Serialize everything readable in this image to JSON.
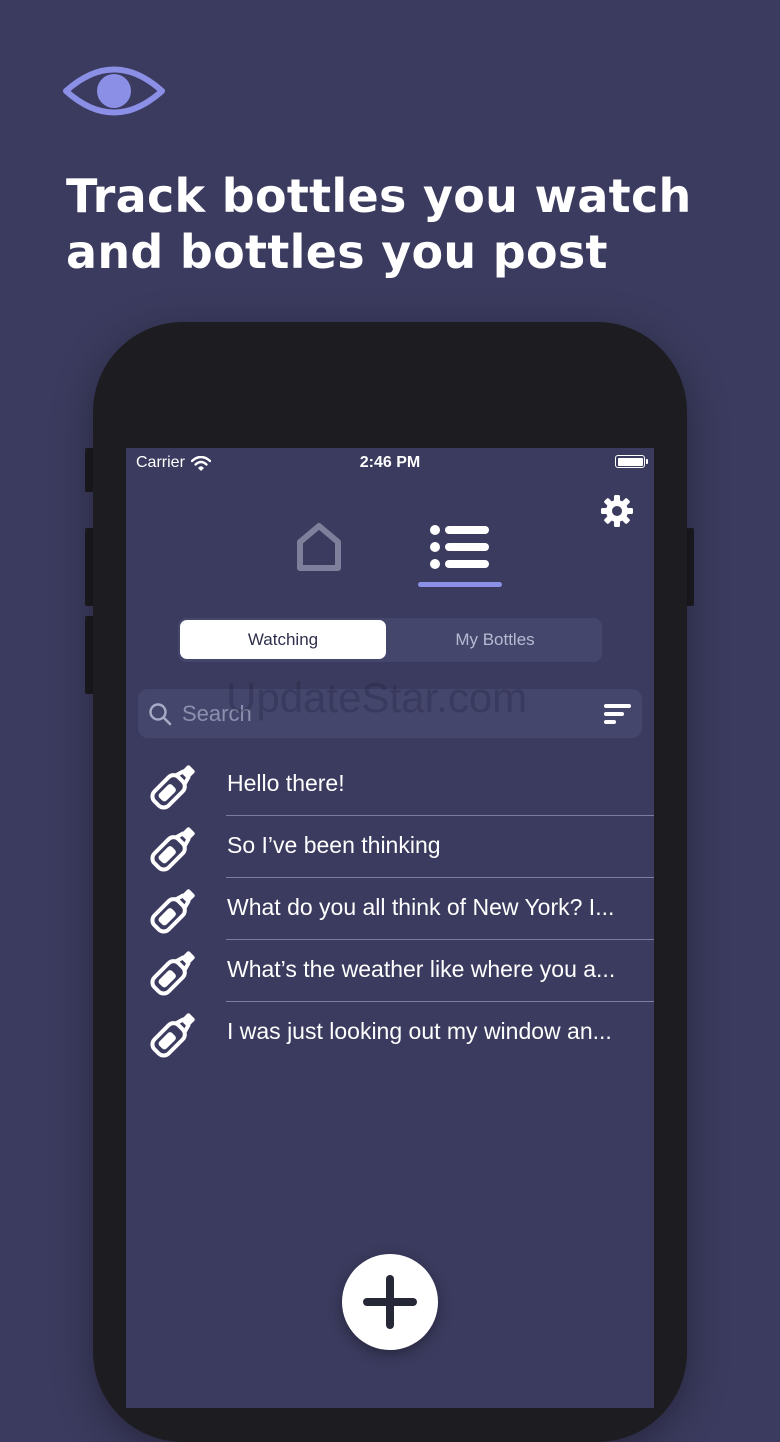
{
  "headline": {
    "line1": "Track bottles you watch",
    "line2": "and bottles you post"
  },
  "status_bar": {
    "carrier": "Carrier",
    "time": "2:46 PM"
  },
  "segments": {
    "watching": "Watching",
    "my_bottles": "My Bottles",
    "selected": "Watching"
  },
  "search": {
    "placeholder": "Search",
    "value": ""
  },
  "watermark": "UpdateStar.com",
  "messages": [
    {
      "text": "Hello there!"
    },
    {
      "text": "So I’ve been thinking"
    },
    {
      "text": "What do you all think of New York? I..."
    },
    {
      "text": "What’s the weather like where you a..."
    },
    {
      "text": "I was just looking out my window an..."
    }
  ],
  "icons": {
    "top": "eye-icon",
    "settings": "gear-icon",
    "tab_home": "home-icon",
    "tab_list": "list-icon",
    "search": "search-icon",
    "sort": "sort-icon",
    "row": "bottle-icon",
    "add": "plus-icon"
  },
  "colors": {
    "background": "#3b3b5f",
    "accent": "#8b8fe6",
    "segment_bg": "#44466c",
    "phone_frame": "#1c1c21"
  }
}
